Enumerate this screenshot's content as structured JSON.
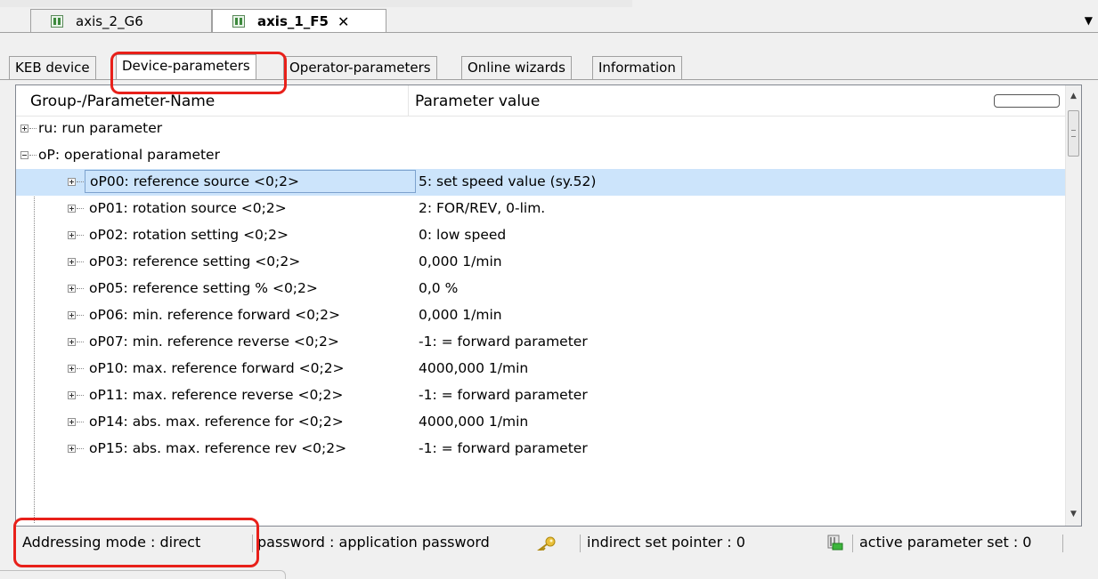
{
  "doc_tabs": [
    {
      "label": "axis_2_G6"
    },
    {
      "label": "axis_1_F5",
      "close": "✕"
    }
  ],
  "doc_dropdown": "▼",
  "property_tabs": [
    {
      "label": "KEB device"
    },
    {
      "label": "Device-parameters"
    },
    {
      "label": "Operator-parameters"
    },
    {
      "label": "Online wizards"
    },
    {
      "label": "Information"
    }
  ],
  "grid": {
    "col_name": "Group-/Parameter-Name",
    "col_value": "Parameter value",
    "rows": [
      {
        "name": "ru: run parameter",
        "value": ""
      },
      {
        "name": "oP: operational parameter",
        "value": ""
      },
      {
        "name": "oP00: reference source <0;2>",
        "value": "5: set speed value (sy.52)"
      },
      {
        "name": "oP01: rotation source <0;2>",
        "value": "2: FOR/REV, 0-lim."
      },
      {
        "name": "oP02: rotation setting <0;2>",
        "value": "0: low speed"
      },
      {
        "name": "oP03: reference setting <0;2>",
        "value": "0,000 1/min"
      },
      {
        "name": "oP05: reference setting % <0;2>",
        "value": "0,0 %"
      },
      {
        "name": "oP06: min. reference forward <0;2>",
        "value": "0,000 1/min"
      },
      {
        "name": "oP07: min. reference reverse <0;2>",
        "value": "-1: = forward parameter"
      },
      {
        "name": "oP10: max. reference forward <0;2>",
        "value": "4000,000 1/min"
      },
      {
        "name": "oP11: max. reference reverse <0;2>",
        "value": "-1: = forward parameter"
      },
      {
        "name": "oP14: abs. max. reference for <0;2>",
        "value": "4000,000 1/min"
      },
      {
        "name": "oP15: abs. max. reference rev <0;2>",
        "value": "-1: = forward parameter"
      }
    ]
  },
  "status": {
    "addressing": "Addressing mode  : direct",
    "password": "password  : application password",
    "indirect": "indirect set pointer  : 0",
    "active_set": "active parameter set  : 0"
  },
  "colors": {
    "highlight": "#e8201a",
    "selection": "#cce4fb"
  }
}
